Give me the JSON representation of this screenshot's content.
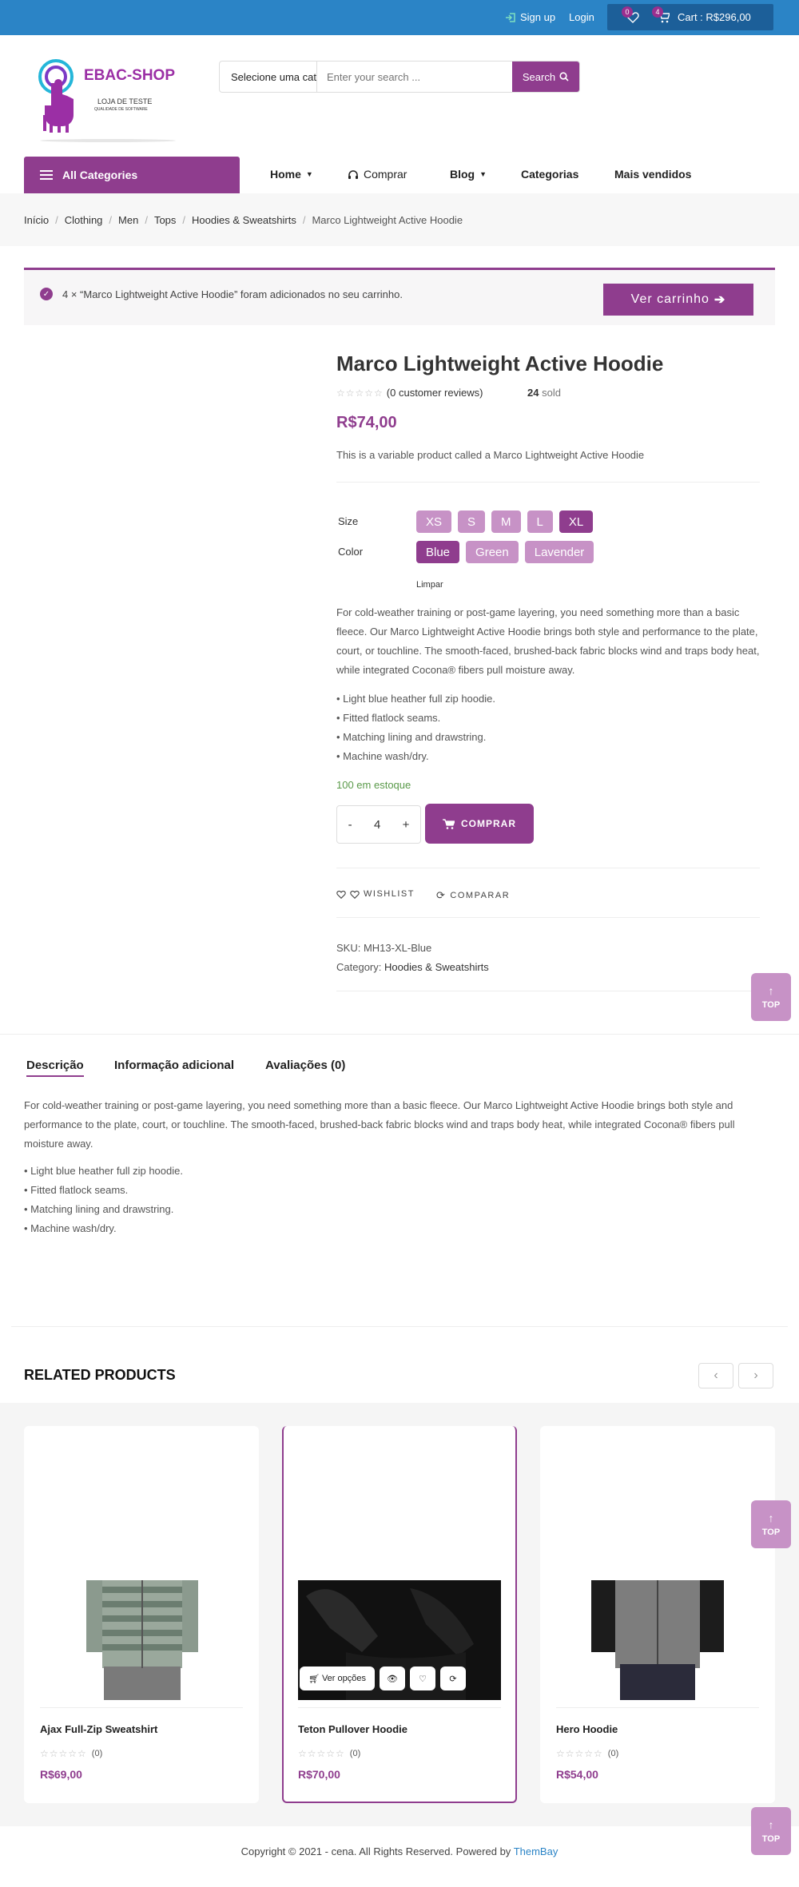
{
  "topbar": {
    "signup": "Sign up",
    "login": "Login",
    "wishlist_count": "0",
    "cart_count": "4",
    "cart_label": "Cart : R$296,00"
  },
  "header": {
    "logo_title": "EBAC-SHOP",
    "logo_sub1": "LOJA DE TESTE",
    "logo_sub2": "QUALIDADE DE SOFTWARE",
    "search_category": "Selecione uma cat",
    "search_placeholder": "Enter your search ...",
    "search_button": "Search"
  },
  "nav": {
    "all_categories": "All Categories",
    "items": [
      "Home",
      "Comprar",
      "Blog",
      "Categorias",
      "Mais vendidos"
    ]
  },
  "breadcrumb": [
    "Início",
    "Clothing",
    "Men",
    "Tops",
    "Hoodies & Sweatshirts",
    "Marco Lightweight Active Hoodie"
  ],
  "notice": {
    "text": "4 × “Marco Lightweight Active Hoodie” foram adicionados no seu carrinho.",
    "button": "Ver carrinho"
  },
  "product": {
    "title": "Marco Lightweight Active Hoodie",
    "stars": "☆☆☆☆☆",
    "reviews": "(0 customer reviews)",
    "sold_count": "24",
    "sold_label": "sold",
    "price": "R$74,00",
    "short_description": "This is a variable product called a Marco Lightweight Active Hoodie",
    "size_label": "Size",
    "sizes": [
      "XS",
      "S",
      "M",
      "L",
      "XL"
    ],
    "selected_size": "XL",
    "color_label": "Color",
    "colors": [
      "Blue",
      "Green",
      "Lavender"
    ],
    "selected_color": "Blue",
    "clear": "Limpar",
    "description": "For cold-weather training or post-game layering, you need something more than a basic fleece. Our Marco Lightweight Active Hoodie brings both style and performance to the plate, court, or touchline. The smooth-faced, brushed-back fabric blocks wind and traps body heat, while integrated Cocona® fibers pull moisture away.",
    "bullets": [
      "• Light blue heather full zip hoodie.",
      "• Fitted flatlock seams.",
      "• Matching lining and drawstring.",
      "• Machine wash/dry."
    ],
    "stock": "100 em estoque",
    "qty_minus": "-",
    "qty_value": "4",
    "qty_plus": "+",
    "buy_button": "COMPRAR",
    "wishlist": "WISHLIST",
    "compare": "COMPARAR",
    "sku_label": "SKU:",
    "sku": "MH13-XL-Blue",
    "category_label": "Category:",
    "category": "Hoodies & Sweatshirts"
  },
  "top_button": "TOP",
  "tabs": [
    "Descrição",
    "Informação adicional",
    "Avaliações (0)"
  ],
  "tab_description": "For cold-weather training or post-game layering, you need something more than a basic fleece. Our Marco Lightweight Active Hoodie brings both style and performance to the plate, court, or touchline. The smooth-faced, brushed-back fabric blocks wind and traps body heat, while integrated Cocona® fibers pull moisture away.",
  "related": {
    "title": "RELATED PRODUCTS",
    "prev": "‹",
    "next": "›",
    "products": [
      {
        "name": "Ajax Full-Zip Sweatshirt",
        "stars": "☆☆☆☆☆",
        "reviews": "(0)",
        "price": "R$69,00"
      },
      {
        "name": "Teton Pullover Hoodie",
        "stars": "☆☆☆☆☆",
        "reviews": "(0)",
        "price": "R$70,00"
      },
      {
        "name": "Hero Hoodie",
        "stars": "☆☆☆☆☆",
        "reviews": "(0)",
        "price": "R$54,00"
      }
    ],
    "ver_opcoes": "Ver opções"
  },
  "footer": {
    "text": "Copyright © 2021 - cena. All Rights Reserved. Powered by",
    "brand": "ThemBay"
  },
  "colors": {
    "brand": "#8f3d8e",
    "topbar": "#2b84c6",
    "swatch": "#c792c6"
  }
}
